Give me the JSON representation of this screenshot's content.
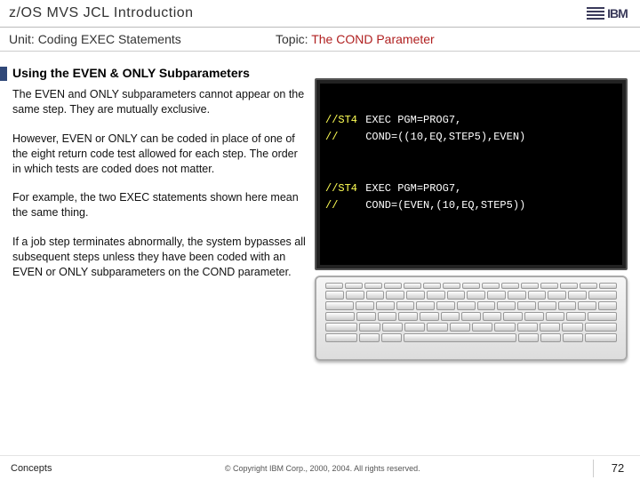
{
  "header": {
    "title": "z/OS MVS JCL Introduction",
    "logo_text": "IBM"
  },
  "subheader": {
    "unit_label": "Unit: ",
    "unit_value": "Coding EXEC Statements",
    "topic_label": "Topic: ",
    "topic_value": "The COND Parameter"
  },
  "heading": "Using the EVEN & ONLY Subparameters",
  "paragraphs": {
    "p1": "The EVEN and ONLY subparameters cannot appear on the same step. They are mutually exclusive.",
    "p2": "However, EVEN or ONLY can be coded in place of one of the eight return code test allowed for each step. The order in which tests are coded does not matter.",
    "p3": "For example, the two EXEC statements shown here mean the same thing.",
    "p4": "If a job step terminates abnormally, the system bypasses all subsequent steps unless they have been coded with an EVEN or ONLY subparameters on the COND parameter."
  },
  "terminal": {
    "l1a": "//ST4",
    "l1b": "EXEC PGM=PROG7,",
    "l2a": "//",
    "l2b": "COND=((10,EQ,STEP5),EVEN)",
    "l3a": "//ST4",
    "l3b": "EXEC PGM=PROG7,",
    "l4a": "//",
    "l4b": "COND=(EVEN,(10,EQ,STEP5))"
  },
  "footer": {
    "concepts": "Concepts",
    "copyright": "© Copyright IBM Corp., 2000, 2004. All rights reserved.",
    "page": "72"
  }
}
